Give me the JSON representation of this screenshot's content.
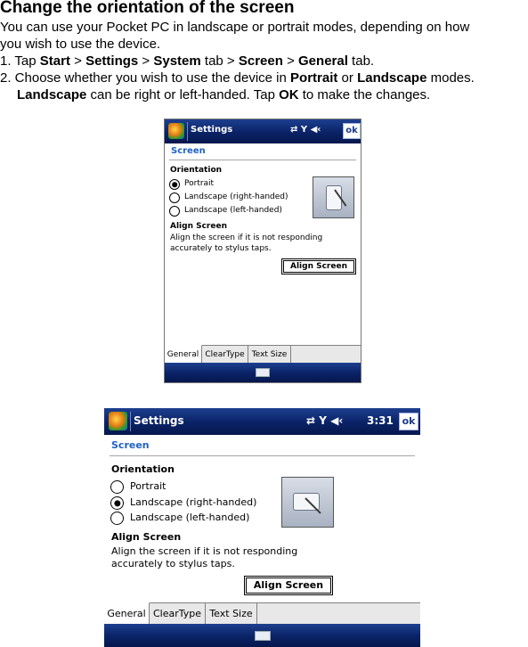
{
  "title": "Change the orientation of the screen",
  "intro_line1": "You can use your Pocket PC in landscape or portrait modes, depending on how",
  "intro_line2": "you wish to use the device.",
  "step1": {
    "num": "1. Tap ",
    "start": "Start",
    "gt1": " > ",
    "settings": "Settings",
    "gt2": " > ",
    "system": "System",
    "tab1": " tab > ",
    "screen": "Screen",
    "gt3": " > ",
    "general": "General",
    "tab2": " tab."
  },
  "step2": {
    "num": "2. Choose whether you wish to use the device in ",
    "portrait": "Portrait",
    "or": " or ",
    "landscape": "Landscape",
    "modes": " modes.",
    "landscape2": "Landscape",
    "mid": " can be right or left-handed. Tap ",
    "ok": "OK",
    "end": " to make the changes."
  },
  "portrait_shot": {
    "app_title": "Settings",
    "ok_label": "ok",
    "status_icons": "⇄ Y ◀‹",
    "section": "Screen",
    "orientation_label": "Orientation",
    "options": [
      "Portrait",
      "Landscape (right-handed)",
      "Landscape (left-handed)"
    ],
    "selected": 0,
    "align_title": "Align Screen",
    "align_text1": "Align the screen if it is not responding",
    "align_text2": "accurately to stylus taps.",
    "align_button": "Align Screen",
    "tabs": [
      "General",
      "ClearType",
      "Text Size"
    ]
  },
  "landscape_shot": {
    "app_title": "Settings",
    "ok_label": "ok",
    "status_icons": "⇄ Y ◀‹",
    "time": "3:31",
    "section": "Screen",
    "orientation_label": "Orientation",
    "options": [
      "Portrait",
      "Landscape (right-handed)",
      "Landscape (left-handed)"
    ],
    "selected": 1,
    "align_title": "Align Screen",
    "align_text1": "Align the screen if it is not responding",
    "align_text2": "accurately to stylus taps.",
    "align_button": "Align Screen",
    "tabs": [
      "General",
      "ClearType",
      "Text Size"
    ]
  },
  "colors": {
    "title_bar": "#0a2266",
    "section_header": "#1f61c4"
  }
}
